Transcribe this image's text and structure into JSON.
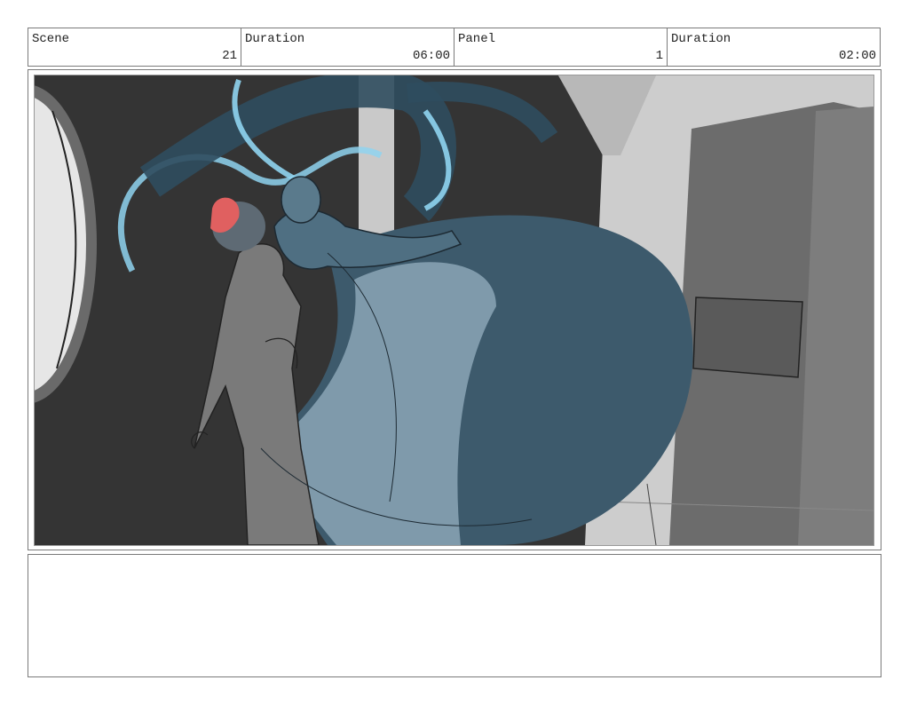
{
  "header": {
    "scene_label": "Scene",
    "scene_value": "21",
    "scene_duration_label": "Duration",
    "scene_duration_value": "06:00",
    "panel_label": "Panel",
    "panel_value": "1",
    "panel_duration_label": "Duration",
    "panel_duration_value": "02:00"
  },
  "notes": {
    "text": ""
  },
  "colors": {
    "frame_border": "#7a7a7a",
    "background_dark": "#333333",
    "wall_light": "#cfcfcf",
    "cloak_dark": "#3b5566",
    "cloak_light": "#7a95a5",
    "glow": "#8fd4f0",
    "hair_red": "#e06060"
  }
}
